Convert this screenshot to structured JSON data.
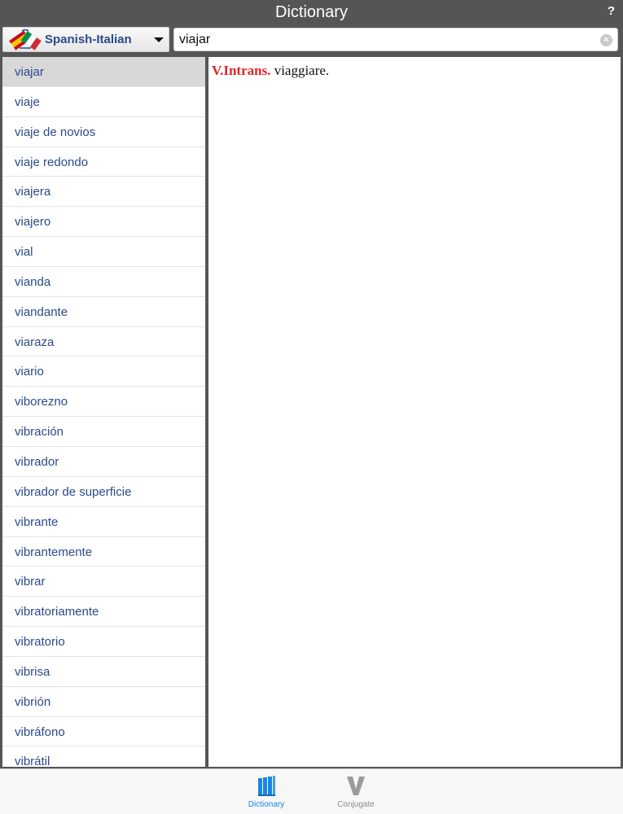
{
  "header": {
    "title": "Dictionary",
    "help_label": "?"
  },
  "search": {
    "language_pair": "Spanish-Italian",
    "query": "viajar"
  },
  "word_list": {
    "selected_index": 0,
    "items": [
      "viajar",
      "viaje",
      "viaje de novios",
      "viaje redondo",
      "viajera",
      "viajero",
      "vial",
      "vianda",
      "viandante",
      "viaraza",
      "viario",
      "viborezno",
      "vibración",
      "vibrador",
      "vibrador de superficie",
      "vibrante",
      "vibrantemente",
      "vibrar",
      "vibratoriamente",
      "vibratorio",
      "vibrisa",
      "vibrión",
      "vibráfono",
      "vibrátil"
    ]
  },
  "definition": {
    "part_of_speech": "V.Intrans.",
    "translation": "viaggiare."
  },
  "tabs": [
    {
      "label": "Dictionary",
      "icon": "books-icon",
      "active": true
    },
    {
      "label": "Conjugate",
      "icon": "v-letter-icon",
      "active": false
    }
  ],
  "colors": {
    "accent": "#1b86e0",
    "word_link": "#2b4a88",
    "part_of_speech": "#e1262a",
    "chrome": "#555555"
  }
}
